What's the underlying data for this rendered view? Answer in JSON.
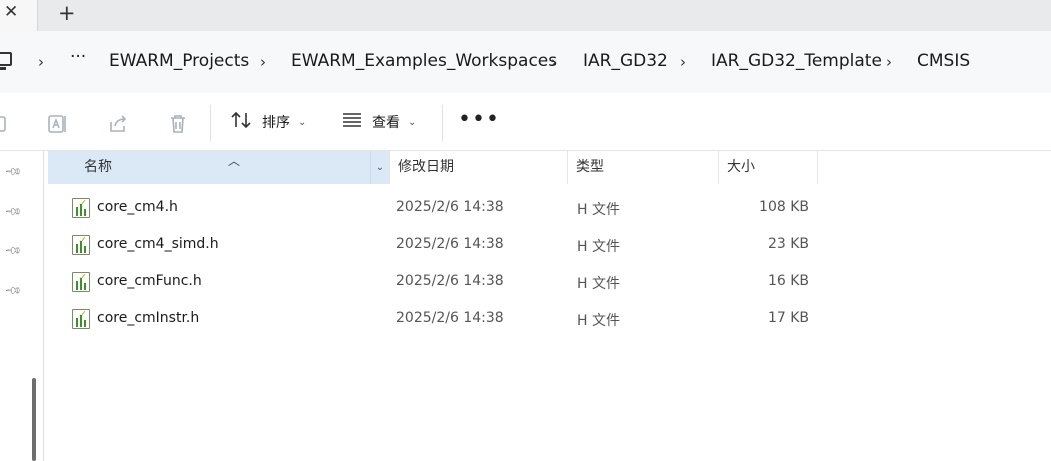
{
  "tabs": {
    "close_glyph": "✕",
    "new_tab_glyph": "+"
  },
  "breadcrumb": {
    "overflow": "···",
    "items": [
      "EWARM_Projects",
      "EWARM_Examples_Workspaces",
      "IAR_GD32",
      "IAR_GD32_Template",
      "CMSIS"
    ],
    "separator": "›"
  },
  "toolbar": {
    "sort_label": "排序",
    "view_label": "查看",
    "more_label": "•••",
    "icons": [
      "new-icon",
      "rename-icon",
      "share-icon",
      "delete-icon"
    ]
  },
  "columns": {
    "name": "名称",
    "date": "修改日期",
    "type": "类型",
    "size": "大小"
  },
  "files": [
    {
      "name": "core_cm4.h",
      "date": "2025/2/6 14:38",
      "type": "H 文件",
      "size": "108 KB"
    },
    {
      "name": "core_cm4_simd.h",
      "date": "2025/2/6 14:38",
      "type": "H 文件",
      "size": "23 KB"
    },
    {
      "name": "core_cmFunc.h",
      "date": "2025/2/6 14:38",
      "type": "H 文件",
      "size": "16 KB"
    },
    {
      "name": "core_cmInstr.h",
      "date": "2025/2/6 14:38",
      "type": "H 文件",
      "size": "17 KB"
    }
  ],
  "colors": {
    "header_selected": "#dbe9f7",
    "tabstrip": "#e9eaec",
    "addressbar": "#f7f8fa"
  }
}
